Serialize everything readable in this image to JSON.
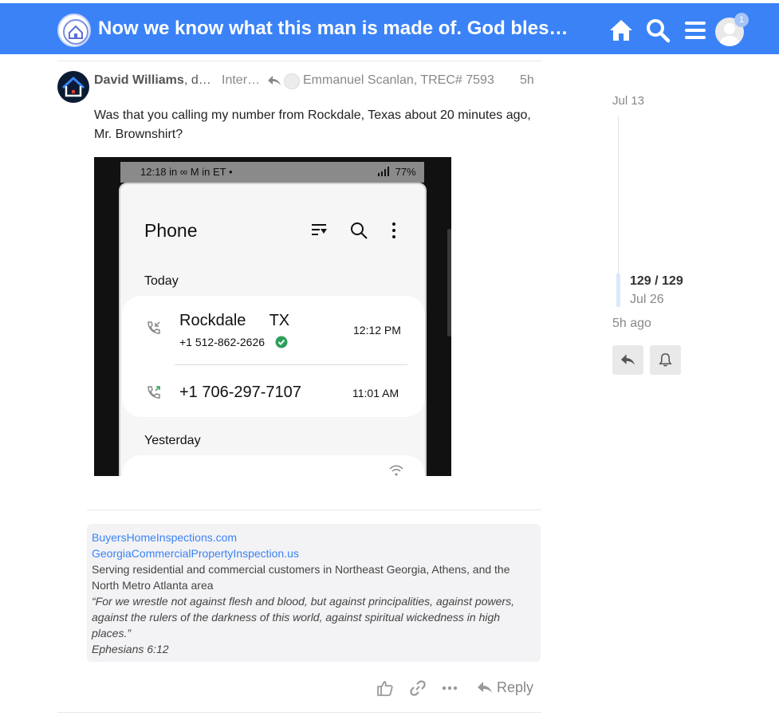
{
  "header": {
    "logo_text": "InterNACHI",
    "title": "Now we know what this man is made of. God bless him",
    "notification_count": "1"
  },
  "post": {
    "author": "David Williams",
    "author_suffix": ", d…",
    "group": "Inter…",
    "reply_to": "Emmanuel Scanlan, TREC# 7593",
    "age": "5h",
    "body": "Was that you calling my number from Rockdale, Texas about 20 minutes ago, Mr. Brownshirt?"
  },
  "screenshot": {
    "status_time": "12:18",
    "status_icons": "in ∞ M in ET •",
    "battery": "77%",
    "app_title": "Phone",
    "section_today": "Today",
    "call1_name": "Rockdale TX",
    "call1_number": "+1 512-862-2626",
    "call1_time": "12:12 PM",
    "call2_number": "+1 706-297-7107",
    "call2_time": "11:01 AM",
    "section_yesterday": "Yesterday"
  },
  "signature": {
    "link1": "BuyersHomeInspections.com",
    "link2": "GeorgiaCommercialPropertyInspection.us",
    "description": "Serving residential and commercial customers in Northeast Georgia, Athens, and the North Metro Atlanta area",
    "quote": "“For we wrestle not against flesh and blood, but against principalities, against powers, against the rulers of the darkness of this world, against spiritual wickedness in high places.”",
    "citation": "Ephesians 6:12"
  },
  "actions": {
    "reply_label": "Reply"
  },
  "timeline": {
    "start_date": "Jul 13",
    "position": "129 / 129",
    "current_date": "Jul 26",
    "ago": "5h ago"
  },
  "colors": {
    "header_bg": "#3b82f6",
    "link": "#3b82f6",
    "muted": "#888888"
  }
}
